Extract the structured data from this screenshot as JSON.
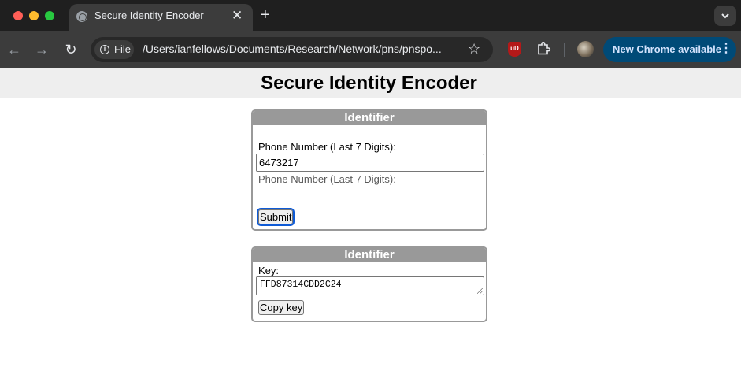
{
  "browser": {
    "tab_title": "Secure Identity Encoder",
    "tab_close": "✕",
    "new_tab": "+",
    "nav": {
      "back": "←",
      "forward": "→",
      "reload": "↻"
    },
    "site_chip": "File",
    "url": "/Users/ianfellows/Documents/Research/Network/pns/pnspo...",
    "bookmark": "☆",
    "extension_badge": "uD",
    "update_button": "New Chrome available",
    "update_menu": "⋮",
    "colors": {
      "tabstrip": "#1f1f1f",
      "toolbar": "#3c3c3c",
      "update_button": "#004a77"
    }
  },
  "page": {
    "title": "Secure Identity Encoder",
    "panels": [
      {
        "header": "Identifier",
        "field_label": "Phone Number (Last 7 Digits):",
        "field_value": "6473217",
        "hint": "Phone Number (Last 7 Digits):",
        "submit_label": "Submit"
      },
      {
        "header": "Identifier",
        "field_label": "Key:",
        "field_value": "FFD87314CDD2C24",
        "copy_label": "Copy key"
      }
    ],
    "colors": {
      "header_bg": "#eeeeee",
      "panel_border": "#999999",
      "focus_ring": "#0f5bd6"
    }
  }
}
